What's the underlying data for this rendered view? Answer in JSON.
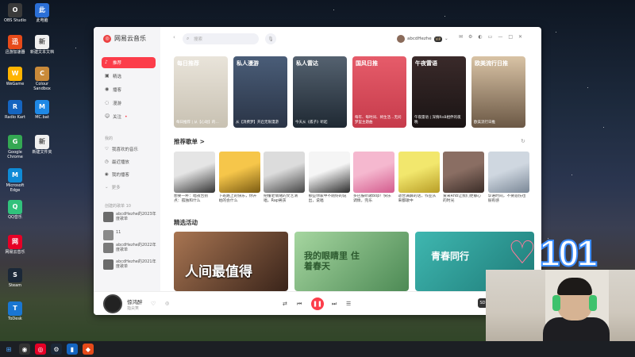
{
  "desktop": {
    "icons": [
      {
        "label": "OBS Studio",
        "icon": "obs-icon",
        "color": "#3a3a3a"
      },
      {
        "label": "此电脑",
        "icon": "computer-icon",
        "color": "#2b6fd6"
      },
      {
        "label": "迅游加速器",
        "icon": "game-accelerator-icon",
        "color": "#e64a19"
      },
      {
        "label": "新建文本文档",
        "icon": "text-file-icon",
        "color": "#f0f0f0"
      },
      {
        "label": "WeGame",
        "icon": "wegame-icon",
        "color": "#ffb400"
      },
      {
        "label": "Colour Sandbox",
        "icon": "app-icon",
        "color": "#c98a3a"
      },
      {
        "label": "Radio Kart",
        "icon": "app-icon-2",
        "color": "#1565c0"
      },
      {
        "label": "MC.bat",
        "icon": "bat-icon",
        "color": "#1e88e5"
      },
      {
        "label": "Google Chrome",
        "icon": "chrome-icon",
        "color": "#34a853"
      },
      {
        "label": "新建文件夹",
        "icon": "file-icon",
        "color": "#f0f0f0"
      },
      {
        "label": "Microsoft Edge",
        "icon": "edge-icon",
        "color": "#0f8bd6"
      },
      {
        "label": "QQ音乐",
        "icon": "qqmusic-icon",
        "color": "#31c27c"
      },
      {
        "label": "网易云音乐",
        "icon": "netease-icon",
        "color": "#e60026"
      },
      {
        "label": "Steam",
        "icon": "steam-icon",
        "color": "#1b2838"
      },
      {
        "label": "ToDesk",
        "icon": "todesk-icon",
        "color": "#1976d2"
      }
    ]
  },
  "app": {
    "title": "网易云音乐",
    "search_placeholder": "搜索",
    "user": {
      "name": "abcdHezhe",
      "vip": "VIP"
    },
    "accent": "#fc3d4a"
  },
  "sidebar": {
    "nav": [
      {
        "label": "推荐",
        "icon": "recommend-icon",
        "active": true
      },
      {
        "label": "精选",
        "icon": "featured-icon",
        "active": false
      },
      {
        "label": "播客",
        "icon": "podcast-icon",
        "active": false
      },
      {
        "label": "漫游",
        "icon": "roam-icon",
        "active": false
      },
      {
        "label": "关注",
        "icon": "follow-icon",
        "active": false
      }
    ],
    "my_section": "我的",
    "my_items": [
      {
        "label": "我喜欢的音乐",
        "icon": "heart-icon"
      },
      {
        "label": "最近播放",
        "icon": "clock-icon"
      },
      {
        "label": "我的播客",
        "icon": "podcast-icon"
      },
      {
        "label": "更多",
        "icon": "chevron-down-icon"
      }
    ],
    "created_section": "创建的歌单 10",
    "playlists": [
      {
        "label": "abcdHezhe的2023年度歌单",
        "color": "#6b6b6b"
      },
      {
        "label": "11",
        "color": "#8a8a8a"
      },
      {
        "label": "abcdHezhe的2022年度歌单",
        "color": "#7a7a7a"
      },
      {
        "label": "abcdHezhe的2021年度歌单",
        "color": "#6a6a6a"
      }
    ]
  },
  "banners": [
    {
      "label": "每日推荐",
      "desc": "每日推荐 | 从【心动】的…",
      "color1": "#e9e4da",
      "color2": "#c8c1b2"
    },
    {
      "label": "私人漫游",
      "desc": "从【消费梦】开启无限漫游",
      "color1": "#4a5d78",
      "color2": "#2a3446"
    },
    {
      "label": "私人雷达",
      "desc": "今天从《孤子》听起",
      "color1": "#556270",
      "color2": "#1f2933"
    },
    {
      "label": "国风日推",
      "desc": "每年、每时间、将生活…无问梦里主题曲",
      "color1": "#e65c6a",
      "color2": "#c63b4b"
    },
    {
      "label": "午夜雷语",
      "desc": "午夜雷语 | 深情RnB相伴的夜晚",
      "color1": "#3a2a2a",
      "color2": "#1a1414"
    },
    {
      "label": "欧美流行日推",
      "desc": "欧美流行日推",
      "color1": "#d9c3a5",
      "color2": "#6b5845"
    }
  ],
  "recommend": {
    "title": "推荐歌单 >",
    "items": [
      {
        "name": "想要一杯：暗夜告别点：孤独和什么",
        "color1": "#e5e5e5",
        "color2": "#333333"
      },
      {
        "name": "下班路上的快乐，你开始的会什么",
        "color1": "#f6c64a",
        "color2": "#7a5b12"
      },
      {
        "name": "把懂老情绪的文艺清唱，Rap男孩",
        "color1": "#dcdcdc",
        "color2": "#444444"
      },
      {
        "name": "那些你家中不刚好的说出，说唱",
        "color1": "#f5f5f5",
        "color2": "#2b2b2b"
      },
      {
        "name": "多巴胺听歌Bop！快乐调情，完乐",
        "color1": "#f5b8cf",
        "color2": "#d35b8d"
      },
      {
        "name": "适合满屏的话，作业从来都歌中",
        "color1": "#f2e76d",
        "color2": "#b89d26"
      },
      {
        "name": "爱来RnB让我们更静心的时光",
        "color1": "#8a6e63",
        "color2": "#3b2d28"
      },
      {
        "name": "华语时间，不要悲伤也很有感",
        "color1": "#cfd7e0",
        "color2": "#7a8796"
      }
    ]
  },
  "activities": {
    "title": "精选活动",
    "items": [
      {
        "text": "人间最值得",
        "color1": "#a87552",
        "color2": "#3a241a"
      },
      {
        "text": "我的眼睛里 住着春天",
        "color1": "#a6d6a0",
        "color2": "#4d8a55"
      },
      {
        "text": "青春同行",
        "color1": "#3fb7b0",
        "color2": "#1e7b78"
      }
    ]
  },
  "player": {
    "song": "惊鸿醉",
    "artist": "指尖笑",
    "sound_label": "SD"
  },
  "overlay": {
    "count": "101"
  }
}
